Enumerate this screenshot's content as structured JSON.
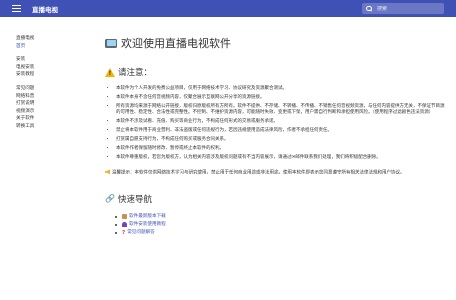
{
  "header": {
    "title": "直播电视",
    "search_placeholder": "搜索"
  },
  "sidebar": {
    "groups": [
      [
        "直播电视",
        "首页"
      ],
      [
        "安装",
        "电视安装",
        "安装教程"
      ],
      [
        "常见问题",
        "网络科普",
        "打赏说明",
        "视频演示",
        "关于软件",
        "转换工具"
      ]
    ]
  },
  "main": {
    "title": "欢迎使用直播电视软件",
    "notice_heading": "请注意：",
    "notice_items": [
      "本软件为个人开发的免费公益项目，仅用于网络技术学习、协议研究及资源聚合测试。",
      "本软件本身不含任何音视频内容，仅聚合展示互联网公开分享的资源链接。",
      "所有资源均来源于网络公开链接，版权归原版权所有方所有。软件不提供、不存储、不转播、不传播、不销售任何音视频资源，与任何内容提供方无关，不保证节目源的可用性、稳定性、合法性或完整性。不控制、不维护资源内容，可能随时失效、变更或下架，用户需自行判断和承担使用风险。（使用程序过滤剧色违法资源）",
      "本软件不涉及试看、充值、购买等商业行为，不构成任何形式的交易或服务承诺。",
      "禁止将本软件用于商业营利、非法盗版或任何违规行为，若因违规使用造成法律风险，作者不承担任何责任。",
      "打赏属自愿支持行为，不构成任何购买或服务合同关系。",
      "本软件作者保留随时修改、暂停或终止本软件的权利。",
      "本软件尊重版权，若您为版权方，认为相关内容涉及版权问题或有不当内容展示，请通过✉邮件联系我们处理，我们将积极配合删除。"
    ],
    "tip": "温馨提示：本软件仅供网络技术学习与研究使用，禁止用于任何商业用途或非法用途。使用本软件即表示您同意遵守所有相关法律法规和用户协议。",
    "quicknav_heading": "快速导航",
    "quicknav_items": [
      {
        "label": "软件最新版本下载",
        "icon": "package-icon"
      },
      {
        "label": "软件安装使用教程",
        "icon": "rocket-icon"
      },
      {
        "label": "常见问题解答",
        "icon": "question-icon"
      }
    ]
  },
  "colors": {
    "header_bg": "#3f51b5",
    "link": "#3f51b5"
  }
}
